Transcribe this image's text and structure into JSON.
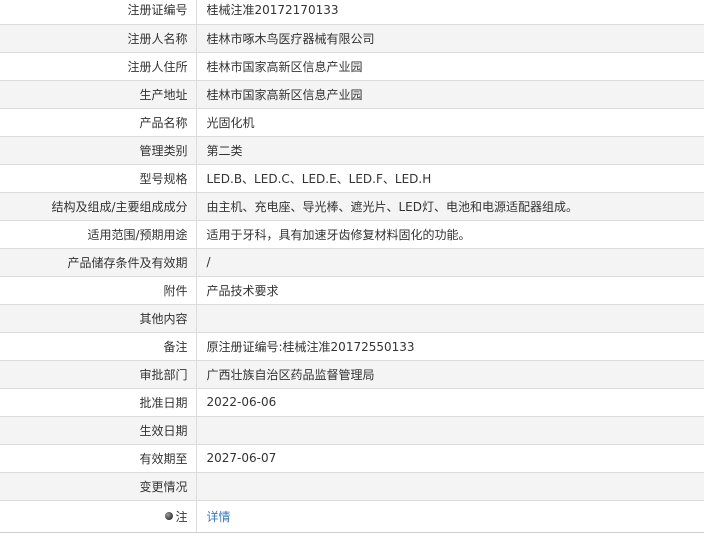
{
  "rows": [
    {
      "label": "注册证编号",
      "value": "桂械注准20172170133"
    },
    {
      "label": "注册人名称",
      "value": "桂林市啄木鸟医疗器械有限公司"
    },
    {
      "label": "注册人住所",
      "value": "桂林市国家高新区信息产业园"
    },
    {
      "label": "生产地址",
      "value": "桂林市国家高新区信息产业园"
    },
    {
      "label": "产品名称",
      "value": "光固化机"
    },
    {
      "label": "管理类别",
      "value": "第二类"
    },
    {
      "label": "型号规格",
      "value": "LED.B、LED.C、LED.E、LED.F、LED.H"
    },
    {
      "label": "结构及组成/主要组成成分",
      "value": "由主机、充电座、导光棒、遮光片、LED灯、电池和电源适配器组成。"
    },
    {
      "label": "适用范围/预期用途",
      "value": "适用于牙科，具有加速牙齿修复材料固化的功能。"
    },
    {
      "label": "产品储存条件及有效期",
      "value": "/"
    },
    {
      "label": "附件",
      "value": "产品技术要求"
    },
    {
      "label": "其他内容",
      "value": ""
    },
    {
      "label": "备注",
      "value": "原注册证编号:桂械注准20172550133"
    },
    {
      "label": "审批部门",
      "value": "广西壮族自治区药品监督管理局"
    },
    {
      "label": "批准日期",
      "value": "2022-06-06"
    },
    {
      "label": "生效日期",
      "value": ""
    },
    {
      "label": "有效期至",
      "value": "2027-06-07"
    },
    {
      "label": "变更情况",
      "value": ""
    }
  ],
  "note": {
    "label": "注",
    "icon": "info-bullet-icon",
    "link_text": "详情",
    "link_color": "#3a78c3"
  }
}
